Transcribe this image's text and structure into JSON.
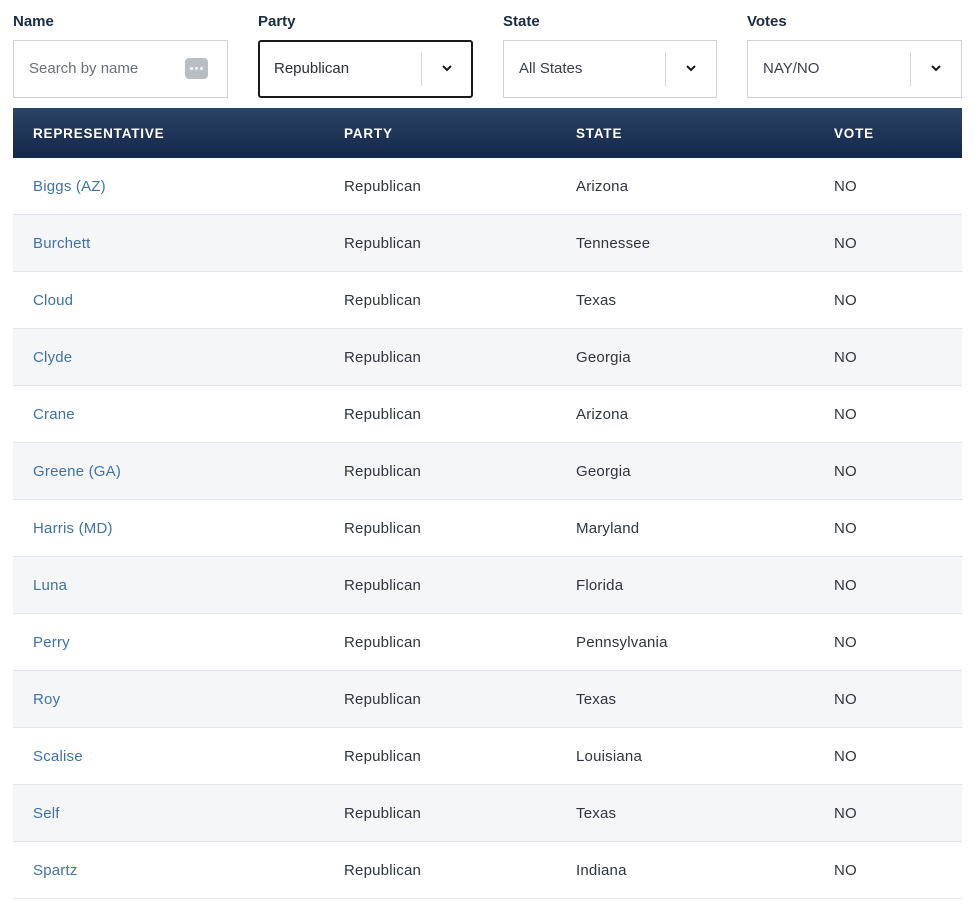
{
  "filters": {
    "name": {
      "label": "Name",
      "placeholder": "Search by name",
      "icon": "more-dots-icon"
    },
    "party": {
      "label": "Party",
      "selected": "Republican"
    },
    "state": {
      "label": "State",
      "selected": "All States"
    },
    "votes": {
      "label": "Votes",
      "selected": "NAY/NO"
    }
  },
  "table": {
    "headers": [
      "REPRESENTATIVE",
      "PARTY",
      "STATE",
      "VOTE"
    ],
    "rows": [
      {
        "name": "Biggs (AZ)",
        "party": "Republican",
        "state": "Arizona",
        "vote": "NO"
      },
      {
        "name": "Burchett",
        "party": "Republican",
        "state": "Tennessee",
        "vote": "NO"
      },
      {
        "name": "Cloud",
        "party": "Republican",
        "state": "Texas",
        "vote": "NO"
      },
      {
        "name": "Clyde",
        "party": "Republican",
        "state": "Georgia",
        "vote": "NO"
      },
      {
        "name": "Crane",
        "party": "Republican",
        "state": "Arizona",
        "vote": "NO"
      },
      {
        "name": "Greene (GA)",
        "party": "Republican",
        "state": "Georgia",
        "vote": "NO"
      },
      {
        "name": "Harris (MD)",
        "party": "Republican",
        "state": "Maryland",
        "vote": "NO"
      },
      {
        "name": "Luna",
        "party": "Republican",
        "state": "Florida",
        "vote": "NO"
      },
      {
        "name": "Perry",
        "party": "Republican",
        "state": "Pennsylvania",
        "vote": "NO"
      },
      {
        "name": "Roy",
        "party": "Republican",
        "state": "Texas",
        "vote": "NO"
      },
      {
        "name": "Scalise",
        "party": "Republican",
        "state": "Louisiana",
        "vote": "NO"
      },
      {
        "name": "Self",
        "party": "Republican",
        "state": "Texas",
        "vote": "NO"
      },
      {
        "name": "Spartz",
        "party": "Republican",
        "state": "Indiana",
        "vote": "NO"
      }
    ]
  },
  "colors": {
    "header_bg": "#1b3053",
    "link": "#3f72a6",
    "row_alt": "#f5f6f8"
  }
}
